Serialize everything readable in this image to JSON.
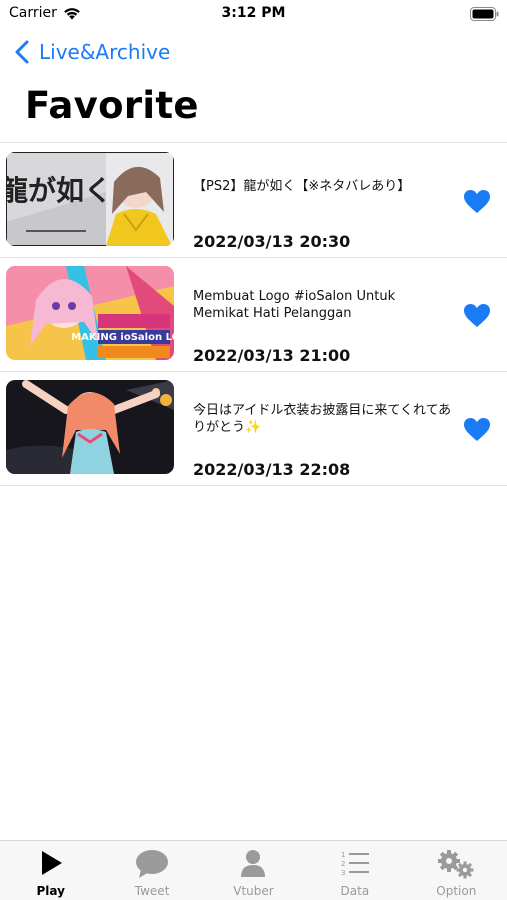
{
  "status_bar": {
    "carrier": "Carrier",
    "time": "3:12 PM"
  },
  "nav": {
    "back_label": "Live&Archive",
    "title": "Favorite"
  },
  "accent_color": "#1a7cf5",
  "items": [
    {
      "title": "【PS2】龍が如く【※ネタバレあり】",
      "date": "2022/03/13 20:30",
      "favorited": true,
      "thumbnail_text": "龍が如く"
    },
    {
      "title": "Membuat Logo #ioSalon Untuk Memikat Hati Pelanggan",
      "date": "2022/03/13 21:00",
      "favorited": true,
      "thumbnail_text": "MAKING ioSalon LOGO"
    },
    {
      "title": "今日はアイドル衣装お披露目に来てくれてありがとう✨",
      "date": "2022/03/13 22:08",
      "favorited": true,
      "thumbnail_text": ""
    }
  ],
  "tabs": [
    {
      "label": "Play",
      "icon": "play-icon",
      "active": true
    },
    {
      "label": "Tweet",
      "icon": "speech-bubble-icon",
      "active": false
    },
    {
      "label": "Vtuber",
      "icon": "person-icon",
      "active": false
    },
    {
      "label": "Data",
      "icon": "numbered-list-icon",
      "active": false
    },
    {
      "label": "Option",
      "icon": "gears-icon",
      "active": false
    }
  ]
}
